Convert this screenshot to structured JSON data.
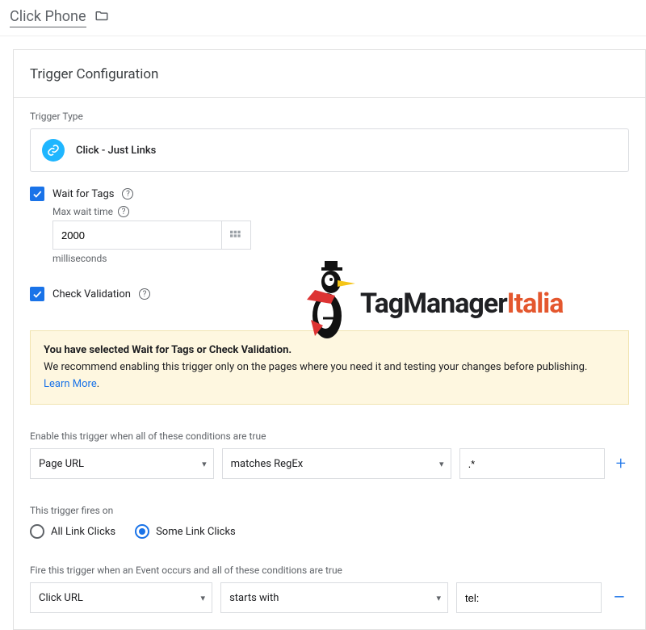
{
  "header": {
    "title": "Click Phone"
  },
  "config": {
    "section_title": "Trigger Configuration",
    "type_label": "Trigger Type",
    "type_value": "Click - Just Links",
    "wait_for_tags": {
      "label": "Wait for Tags",
      "max_wait_label": "Max wait time",
      "max_wait_value": "2000",
      "unit": "milliseconds"
    },
    "check_validation": {
      "label": "Check Validation"
    },
    "warning": {
      "bold": "You have selected Wait for Tags or Check Validation.",
      "text": "We recommend enabling this trigger only on the pages where you need it and testing your changes before publishing. ",
      "link": "Learn More"
    },
    "enable_label": "Enable this trigger when all of these conditions are true",
    "enable_cond": {
      "var": "Page URL",
      "op": "matches RegEx",
      "val": ".*"
    },
    "fires_on_label": "This trigger fires on",
    "fires_on": {
      "all": "All Link Clicks",
      "some": "Some Link Clicks",
      "selected": "some"
    },
    "fire_when_label": "Fire this trigger when an Event occurs and all of these conditions are true",
    "fire_cond": {
      "var": "Click URL",
      "op": "starts with",
      "val": "tel:"
    }
  },
  "logo": {
    "brand1": "TagManager",
    "brand2": "Italia"
  }
}
